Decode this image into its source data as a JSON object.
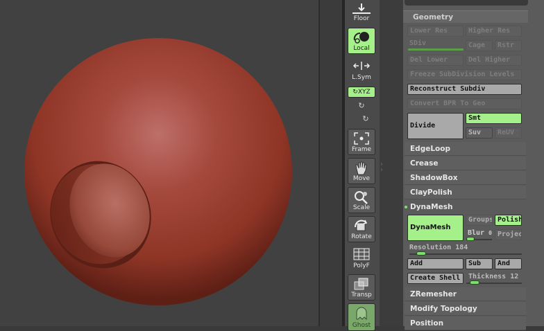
{
  "shelf": {
    "floor": "Floor",
    "local": "Local",
    "lsym": "L.Sym",
    "xyz": "XYZ",
    "y_axis": "Y",
    "z_axis": "Z",
    "frame": "Frame",
    "move": "Move",
    "scale": "Scale",
    "rotate": "Rotate",
    "polyf": "PolyF",
    "transp": "Transp",
    "ghost": "Ghost"
  },
  "panel": {
    "title": "Geometry",
    "lower_res": "Lower Res",
    "higher_res": "Higher Res",
    "sdiv": "SDiv",
    "cage": "Cage",
    "rstr": "Rstr",
    "del_lower": "Del Lower",
    "del_higher": "Del Higher",
    "freeze": "Freeze SubDivision Levels",
    "reconstruct": "Reconstruct Subdiv",
    "convert_bpr": "Convert BPR To Geo",
    "divide": "Divide",
    "smt": "Smt",
    "suv": "Suv",
    "reuv": "ReUV",
    "sections": {
      "edgeloop": "EdgeLoop",
      "crease": "Crease",
      "shadowbox": "ShadowBox",
      "claypolish": "ClayPolish",
      "dynamesh": "DynaMesh",
      "zremesher": "ZRemesher",
      "modify_topology": "Modify Topology",
      "position": "Position"
    },
    "dynamesh": {
      "button": "DynaMesh",
      "groups": "Groups",
      "polish": "Polish",
      "blur_label": "Blur",
      "blur_value": "0",
      "project": "Project",
      "resolution_label": "Resolution",
      "resolution_value": "184",
      "add": "Add",
      "sub": "Sub",
      "and": "And",
      "create_shell": "Create Shell",
      "thickness_label": "Thickness",
      "thickness_value": "12"
    }
  },
  "colors": {
    "accent_green": "#a6f08c",
    "sphere": "#a24a3c",
    "panel": "#5b5b5b",
    "viewport": "#414141"
  }
}
